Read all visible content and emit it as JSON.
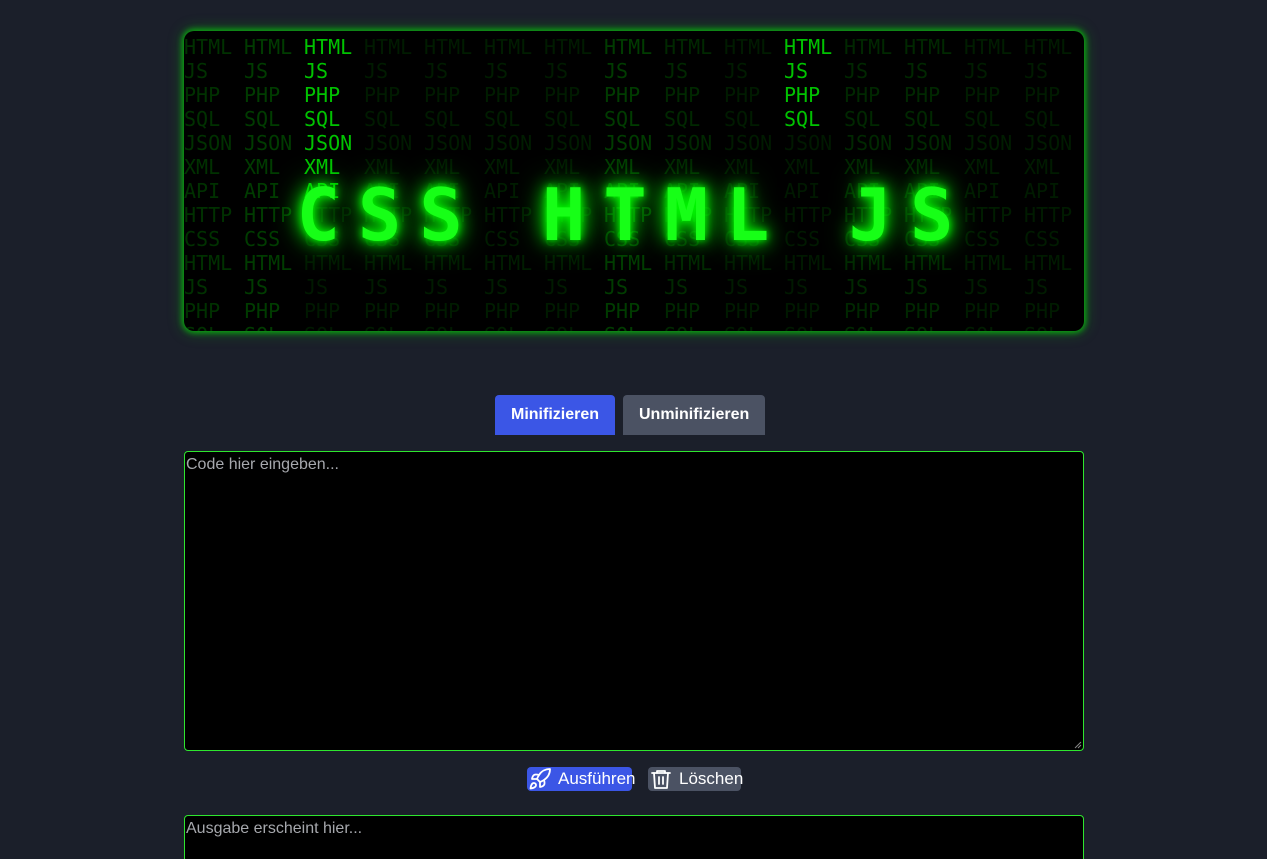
{
  "banner": {
    "title": "CSS HTML JS",
    "matrix_words": [
      "HTML",
      "JS",
      "PHP",
      "SQL",
      "JSON",
      "XML",
      "API",
      "HTTP",
      "CSS",
      "HTML",
      "JS",
      "PHP",
      "SQL"
    ],
    "neon_color": "#00ff00"
  },
  "tabs": [
    {
      "label": "Minifizieren",
      "active": true
    },
    {
      "label": "Unminifizieren",
      "active": false
    }
  ],
  "input": {
    "placeholder": "Code hier eingeben...",
    "value": ""
  },
  "actions": {
    "run_label": "Ausführen",
    "run_icon": "rocket-icon",
    "clear_label": "Löschen",
    "clear_icon": "trash-icon"
  },
  "output": {
    "placeholder": "Ausgabe erscheint hier...",
    "value": ""
  },
  "colors": {
    "background": "#1b1f2a",
    "accent_blue": "#3b56e6",
    "button_gray": "#4b5263",
    "border_green": "#2ee62e"
  }
}
